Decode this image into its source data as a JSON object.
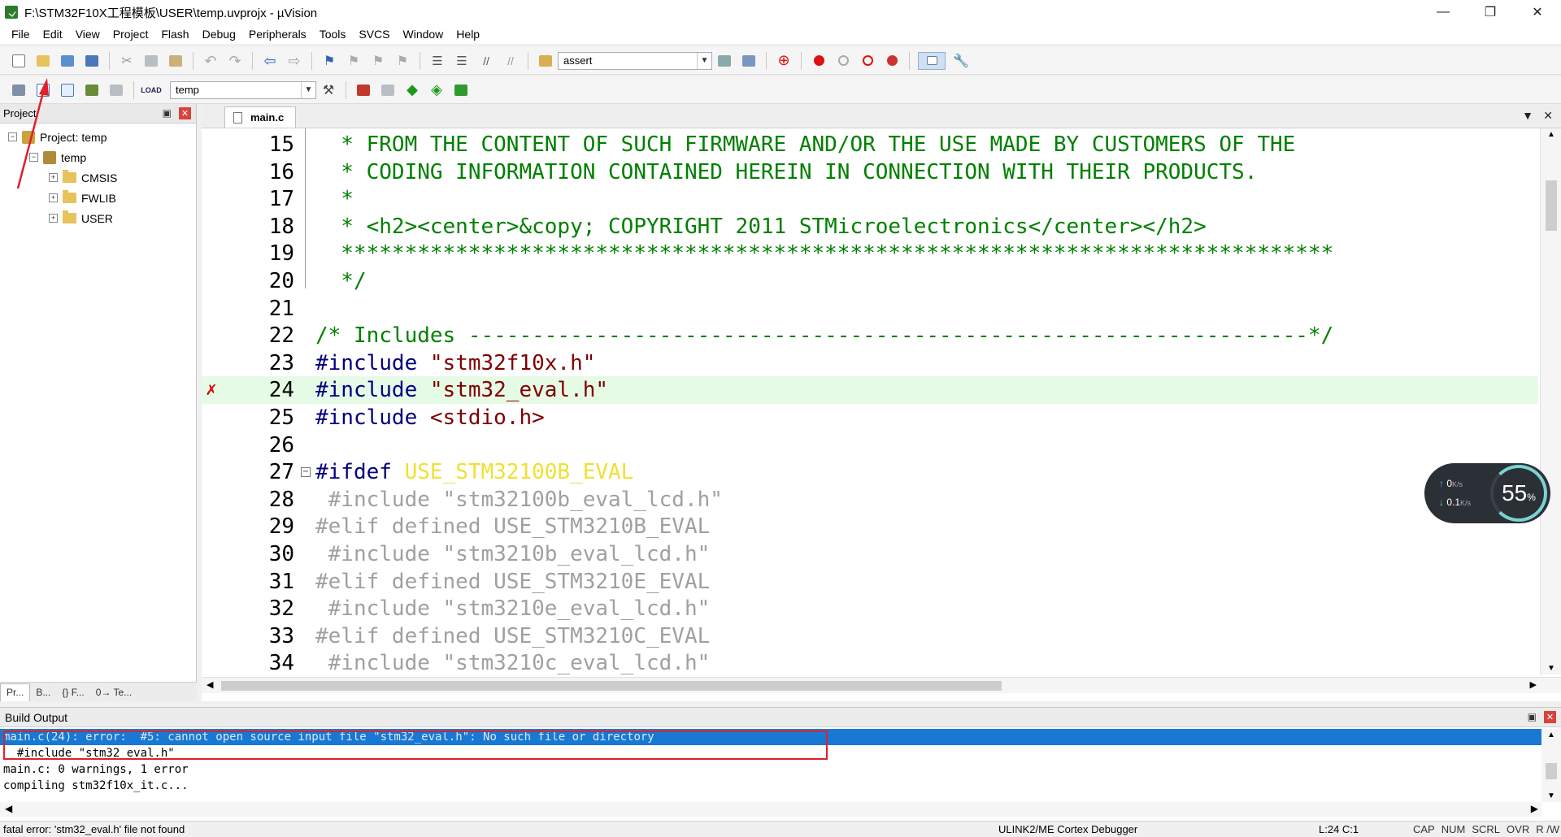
{
  "window": {
    "title": "F:\\STM32F10X工程模板\\USER\\temp.uvprojx - µVision",
    "minimize": "—",
    "restore": "❐",
    "close": "✕"
  },
  "menu": [
    "File",
    "Edit",
    "View",
    "Project",
    "Flash",
    "Debug",
    "Peripherals",
    "Tools",
    "SVCS",
    "Window",
    "Help"
  ],
  "toolbar": {
    "find_combo": "assert",
    "target_combo": "temp"
  },
  "project_panel": {
    "title": "Project",
    "pin": "📌",
    "close": "✕",
    "tree": [
      {
        "label": "Project: temp",
        "level": 0,
        "expander": "−",
        "icon": "project-icon"
      },
      {
        "label": "temp",
        "level": 1,
        "expander": "−",
        "icon": "target-icon"
      },
      {
        "label": "CMSIS",
        "level": 2,
        "expander": "+",
        "icon": "folder-icon"
      },
      {
        "label": "FWLIB",
        "level": 2,
        "expander": "+",
        "icon": "folder-icon"
      },
      {
        "label": "USER",
        "level": 2,
        "expander": "+",
        "icon": "folder-icon"
      }
    ],
    "tabs": [
      "Pr...",
      "B...",
      "{} F...",
      "0→ Te..."
    ]
  },
  "editor": {
    "tab": "main.c",
    "lines": [
      {
        "n": "15",
        "text": "  * FROM THE CONTENT OF SUCH FIRMWARE AND/OR THE USE MADE BY CUSTOMERS OF THE",
        "cls": "comment"
      },
      {
        "n": "16",
        "text": "  * CODING INFORMATION CONTAINED HEREIN IN CONNECTION WITH THEIR PRODUCTS.",
        "cls": "comment"
      },
      {
        "n": "17",
        "text": "  *",
        "cls": "comment"
      },
      {
        "n": "18",
        "text": "  * <h2><center>&copy; COPYRIGHT 2011 STMicroelectronics</center></h2>",
        "cls": "comment"
      },
      {
        "n": "19",
        "text": "  ******************************************************************************",
        "cls": "comment"
      },
      {
        "n": "20",
        "text": "  */",
        "cls": "comment"
      },
      {
        "n": "21",
        "text": "",
        "cls": "comment"
      },
      {
        "n": "22",
        "text": "/* Includes ------------------------------------------------------------------*/",
        "cls": "comment"
      },
      {
        "n": "23",
        "text": "#include \"stm32f10x.h\"",
        "cls": "include"
      },
      {
        "n": "24",
        "text": "#include \"stm32_eval.h\"",
        "cls": "include",
        "highlight": true,
        "error_mark": "✗"
      },
      {
        "n": "25",
        "text": "#include <stdio.h>",
        "cls": "include"
      },
      {
        "n": "26",
        "text": "",
        "cls": "plain"
      },
      {
        "n": "27",
        "text": "#ifdef USE_STM32100B_EVAL",
        "cls": "ifdef",
        "fold": "−"
      },
      {
        "n": "28",
        "text": " #include \"stm32100b_eval_lcd.h\"",
        "cls": "inactive"
      },
      {
        "n": "29",
        "text": "#elif defined USE_STM3210B_EVAL",
        "cls": "inactive"
      },
      {
        "n": "30",
        "text": " #include \"stm3210b_eval_lcd.h\"",
        "cls": "inactive"
      },
      {
        "n": "31",
        "text": "#elif defined USE_STM3210E_EVAL",
        "cls": "inactive"
      },
      {
        "n": "32",
        "text": " #include \"stm3210e_eval_lcd.h\"",
        "cls": "inactive"
      },
      {
        "n": "33",
        "text": "#elif defined USE_STM3210C_EVAL",
        "cls": "inactive"
      },
      {
        "n": "34",
        "text": " #include \"stm3210c_eval_lcd.h\"",
        "cls": "inactive"
      }
    ]
  },
  "network_widget": {
    "up": "0",
    "up_unit": "K/s",
    "down": "0.1",
    "down_unit": "K/s",
    "percent": "55",
    "percent_unit": "%"
  },
  "build_output": {
    "title": "Build Output",
    "lines": [
      {
        "text": "main.c(24): error:  #5: cannot open source input file \"stm32_eval.h\": No such file or directory",
        "selected": true
      },
      {
        "text": "  #include \"stm32_eval.h\"",
        "selected": false
      },
      {
        "text": "main.c: 0 warnings, 1 error",
        "selected": false
      },
      {
        "text": "compiling stm32f10x_it.c...",
        "selected": false
      }
    ]
  },
  "status_bar": {
    "message": "fatal error: 'stm32_eval.h' file not found",
    "debugger": "ULINK2/ME Cortex Debugger",
    "position": "L:24 C:1",
    "flags": [
      "CAP",
      "NUM",
      "SCRL",
      "OVR",
      "R /W"
    ]
  },
  "colors": {
    "comment": "#008000",
    "preprocessor": "#000080",
    "string": "#800000",
    "inactive": "#a0a0a0",
    "selection": "#1879d4",
    "error_box": "#e0202a",
    "highlight_line": "#e6fbe6"
  }
}
